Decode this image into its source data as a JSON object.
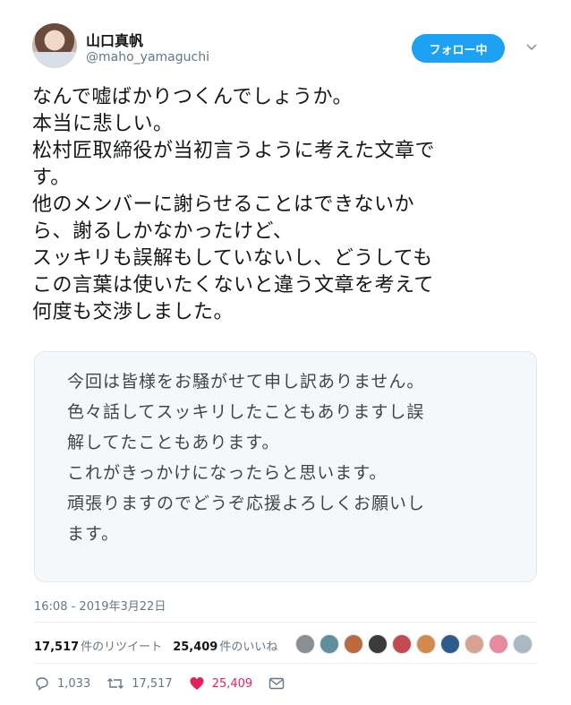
{
  "user": {
    "display_name": "山口真帆",
    "handle": "@maho_yamaguchi"
  },
  "follow_button": {
    "label": "フォロー中"
  },
  "tweet": {
    "text": "なんで嘘ばかりつくんでしょうか。\n本当に悲しい。\n松村匠取締役が当初言うように考えた文章で\nす。\n他のメンバーに謝らせることはできないか\nら、謝るしかなかったけど、\nスッキリも誤解もしていないし、どうしても\nこの言葉は使いたくないと違う文章を考えて\n何度も交渉しました。"
  },
  "quote": {
    "text": "今回は皆様をお騒がせて申し訳ありません。\n色々話してスッキリしたこともありますし誤\n解してたこともあります。\nこれがきっかけになったらと思います。\n頑張りますのでどうぞ応援よろしくお願いし\nます。"
  },
  "timestamp": "16:08 - 2019年3月22日",
  "stats": {
    "retweet_count": "17,517",
    "retweet_label": "件のリツイート",
    "like_count": "25,409",
    "like_label": "件のいいね"
  },
  "liker_avatars": [
    "#8a8f96",
    "#5f8f9e",
    "#b96a3f",
    "#3b3b3b",
    "#c24b52",
    "#d38a4d",
    "#2e5b8a",
    "#d7a28f",
    "#e58aa0",
    "#aab8c2"
  ],
  "actions": {
    "reply_count": "1,033",
    "retweet_count": "17,517",
    "like_count": "25,409"
  },
  "colors": {
    "accent": "#1da1f2",
    "like": "#e0245e",
    "muted": "#657786"
  }
}
